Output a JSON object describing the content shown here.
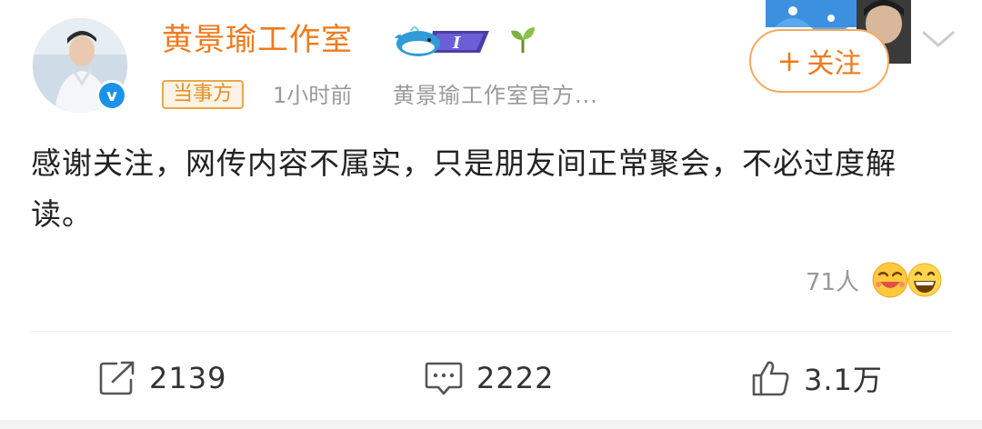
{
  "post": {
    "username": "黄景瑜工作室",
    "tag": "当事方",
    "time": "1小时前",
    "source": "黄景瑜工作室官方...",
    "follow_label": "关注",
    "content": "感谢关注，网传内容不属实，只是朋友间正常聚会，不必过度解读。",
    "reaction_count": "71人"
  },
  "actions": {
    "repost": "2139",
    "comment": "2222",
    "like": "3.1万"
  },
  "colors": {
    "accent": "#f07a1d",
    "verified": "#1a92e8",
    "secondary_text": "#999999"
  },
  "icons": [
    "verified-icon",
    "whale-badge-icon",
    "sprout-icon",
    "chevron-down-icon",
    "repost-icon",
    "comment-icon",
    "like-icon",
    "laugh-emoji-icon",
    "grin-emoji-icon"
  ]
}
